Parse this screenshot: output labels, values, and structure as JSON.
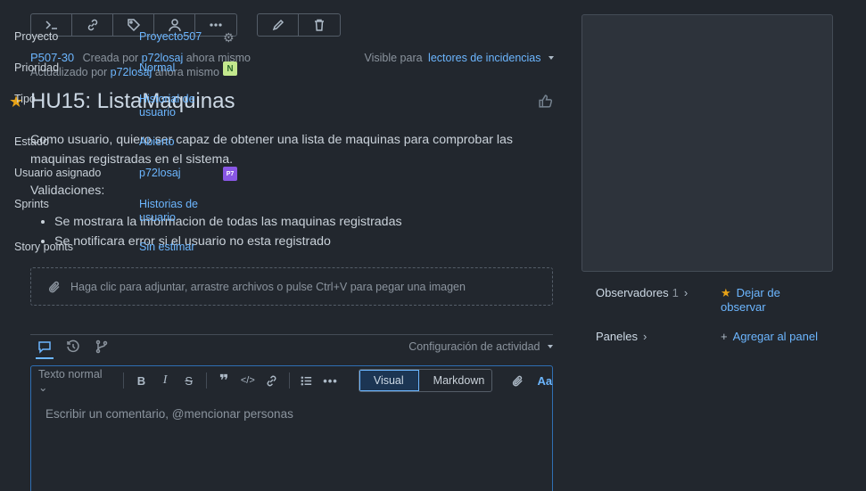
{
  "toolbar": {
    "group1": [
      "terminal-icon",
      "link-icon",
      "tag-icon",
      "user-icon",
      "more-icon"
    ],
    "group2": [
      "pencil-icon",
      "trash-icon"
    ]
  },
  "meta": {
    "key": "P507-30",
    "created_prefix": "Creada por",
    "created_user": "p72losaj",
    "created_when": "ahora mismo",
    "updated_prefix": "Actualizado por",
    "updated_user": "p72losaj",
    "updated_when": "ahora mismo",
    "visible_prefix": "Visible para",
    "visible_target": "lectores de incidencias"
  },
  "title": "HU15: ListaMaquinas",
  "description": {
    "paragraph": "Como usuario, quiero ser capaz de obtener una lista de maquinas para comprobar las maquinas registradas en el sistema.",
    "validations_heading": "Validaciones:",
    "items": [
      "Se mostrara la informacion de todas las maquinas registradas",
      "Se notificara error si el usuario no esta registrado"
    ]
  },
  "attach_text": "Haga clic para adjuntar, arrastre archivos o pulse Ctrl+V para pegar una imagen",
  "activity": {
    "config_label": "Configuración de actividad"
  },
  "editor": {
    "text_style": "Texto normal",
    "mode_visual": "Visual",
    "mode_markdown": "Markdown",
    "aa": "Aa",
    "placeholder": "Escribir un comentario, @mencionar personas"
  },
  "fields": [
    {
      "label": "Proyecto",
      "value": "Proyecto507",
      "icon": "gear-icon"
    },
    {
      "label": "Prioridad",
      "value": "Normal",
      "icon": "priority-badge",
      "badge": "N"
    },
    {
      "label": "Tipo",
      "value": "Historial de usuario"
    },
    {
      "label": "Estado",
      "value": "Abierto"
    },
    {
      "label": "Usuario asignado",
      "value": "p72losaj",
      "icon": "avatar",
      "avatar_text": "P7"
    },
    {
      "label": "Sprints",
      "value": "Historias de usuario"
    },
    {
      "label": "Story points",
      "value": "Sin estimar"
    }
  ],
  "watchers": {
    "label": "Observadores",
    "count": "1",
    "action": "Dejar de observar"
  },
  "boards": {
    "label": "Paneles",
    "action": "Agregar al panel"
  },
  "colors": {
    "background": "#22272e",
    "panel": "#2d333b",
    "link": "#6cb6ff",
    "star": "#e8a317"
  }
}
